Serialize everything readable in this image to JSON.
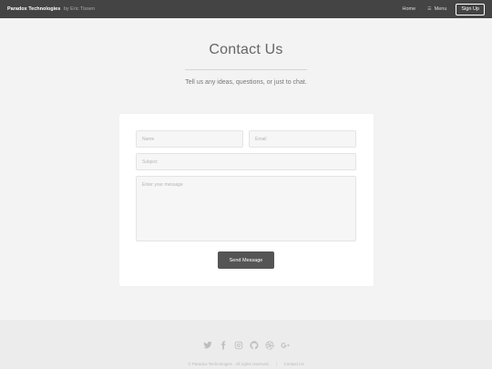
{
  "header": {
    "brand": "Paradox Technologies",
    "brand_by": "by Eric Tissen",
    "nav_home": "Home",
    "nav_menu": "Menu",
    "nav_menu_icon": "hamburger-icon",
    "signup": "Sign Up"
  },
  "hero": {
    "title": "Contact Us",
    "subtitle": "Tell us any ideas, questions, or just to chat."
  },
  "form": {
    "name_placeholder": "Name",
    "email_placeholder": "Email",
    "subject_placeholder": "Subject",
    "message_placeholder": "Enter your message",
    "submit": "Send Message"
  },
  "footer": {
    "social_icons": [
      "twitter-icon",
      "facebook-icon",
      "instagram-icon",
      "github-icon",
      "dribbble-icon",
      "google-plus-icon"
    ],
    "copyright": "© Paradox Technologies . All rights reserved.",
    "contact_link": "Contact Us"
  },
  "colors": {
    "header_bg": "#444444",
    "page_bg": "#f3f3f3",
    "button_bg": "#555555"
  }
}
